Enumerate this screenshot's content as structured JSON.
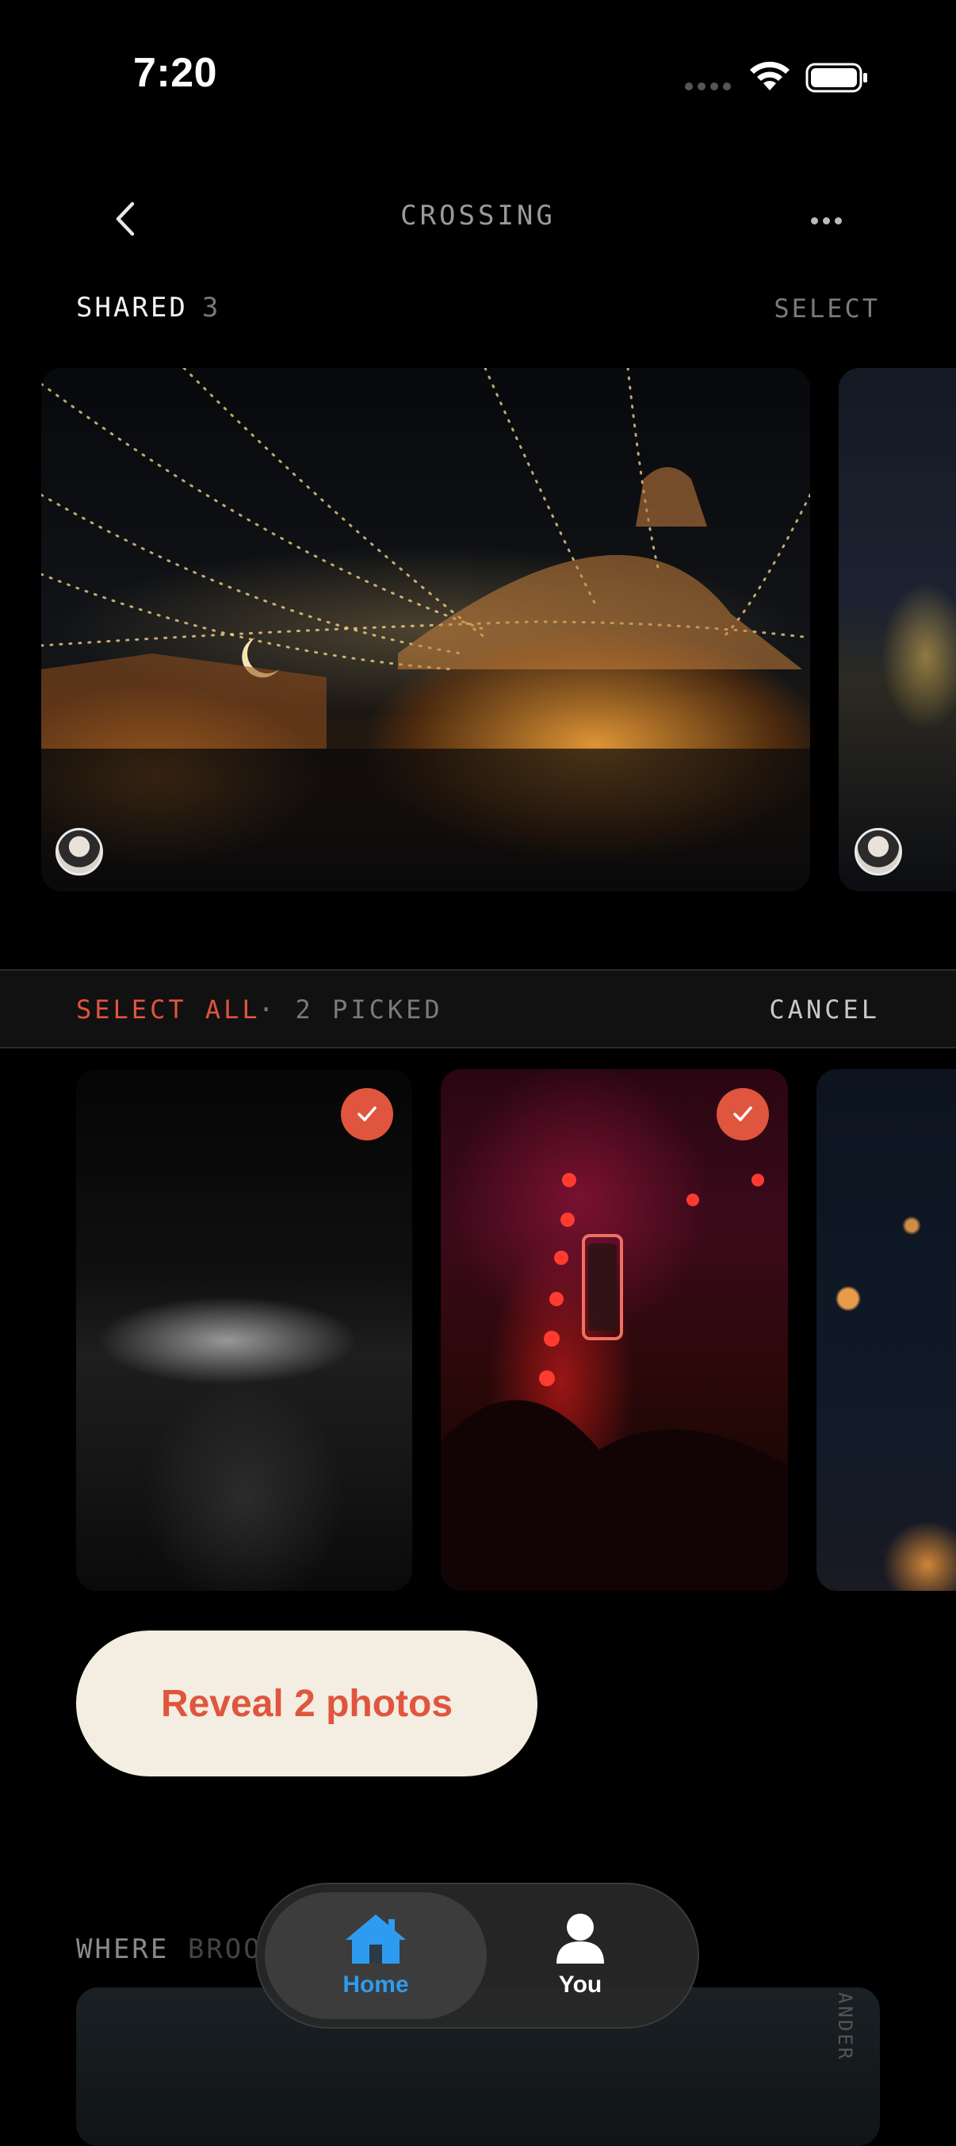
{
  "status": {
    "time": "7:20"
  },
  "nav": {
    "title": "CROSSING"
  },
  "shared": {
    "label": "SHARED",
    "count": "3",
    "select_label": "SELECT"
  },
  "selection": {
    "select_all": "SELECT ALL",
    "picked": "· 2 PICKED",
    "cancel": "CANCEL"
  },
  "reveal": {
    "label": "Reveal 2 photos"
  },
  "where": {
    "label": "WHERE",
    "sub": "BROO"
  },
  "map": {
    "side_text": "ANDER"
  },
  "tabs": [
    {
      "label": "Home",
      "icon": "home-icon",
      "active": true
    },
    {
      "label": "You",
      "icon": "person-icon",
      "active": false
    }
  ],
  "colors": {
    "accent": "#e0553e",
    "tab_active": "#2d9cf0",
    "reveal_bg": "#f4ede1"
  }
}
